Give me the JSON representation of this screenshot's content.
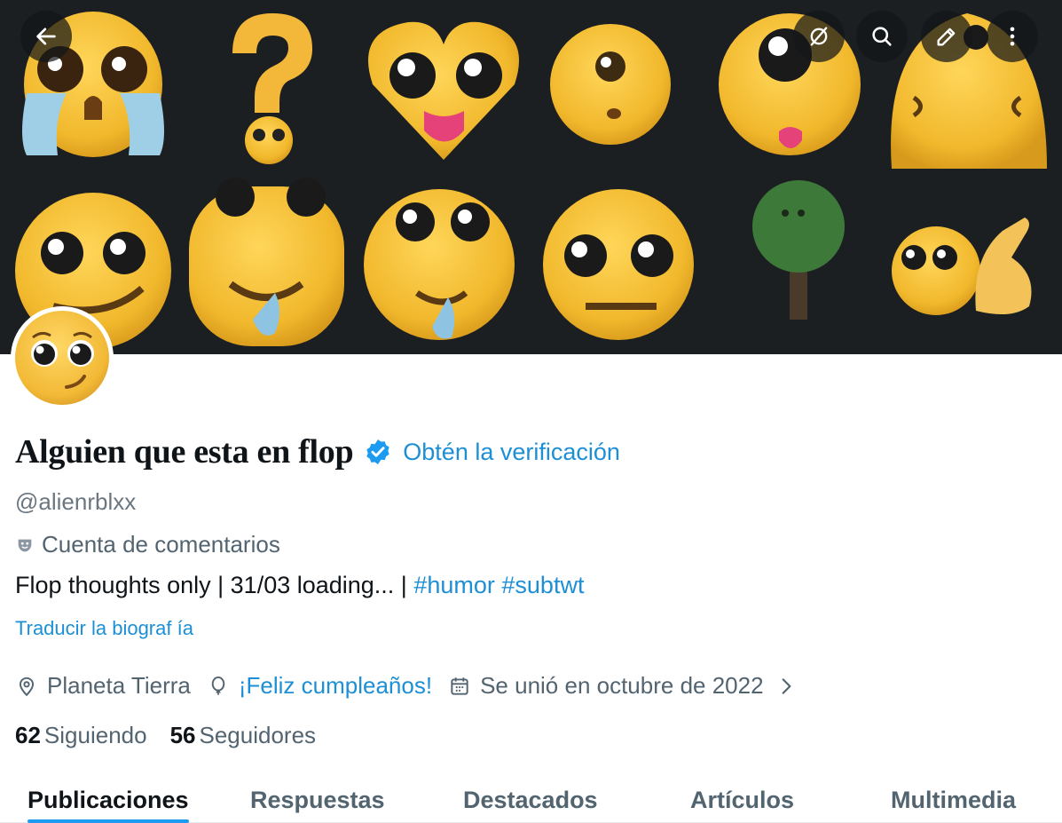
{
  "header": {
    "back_icon": "arrow-left-icon",
    "actions": [
      "no-location-icon",
      "search-icon",
      "edit-icon",
      "more-vertical-icon"
    ]
  },
  "profile": {
    "display_name": "Alguien que esta en flop",
    "verified_icon": "verified-badge-icon",
    "get_verified": "Obtén la verificación",
    "handle": "@alienrblxx",
    "category": "Cuenta de comentarios",
    "bio_text": "Flop thoughts only | 31/03 loading... | ",
    "bio_hashtags": [
      "#humor",
      "#subtwt"
    ],
    "translate_bio": "Traducir la biograf ía",
    "location": "Planeta Tierra",
    "birthday": "¡Feliz cumpleaños!",
    "joined": "Se unió en octubre de 2022",
    "following_count": "62",
    "following_label": "Siguiendo",
    "followers_count": "56",
    "followers_label": "Seguidores"
  },
  "tabs": [
    {
      "label": "Publicaciones",
      "active": true
    },
    {
      "label": "Respuestas",
      "active": false
    },
    {
      "label": "Destacados",
      "active": false
    },
    {
      "label": "Artículos",
      "active": false
    },
    {
      "label": "Multimedia",
      "active": false
    }
  ],
  "colors": {
    "accent": "#1d9bf0",
    "link": "#1d8fd6",
    "banner_bg": "#1c1f22",
    "emoji_yellow": "#f3c136"
  }
}
